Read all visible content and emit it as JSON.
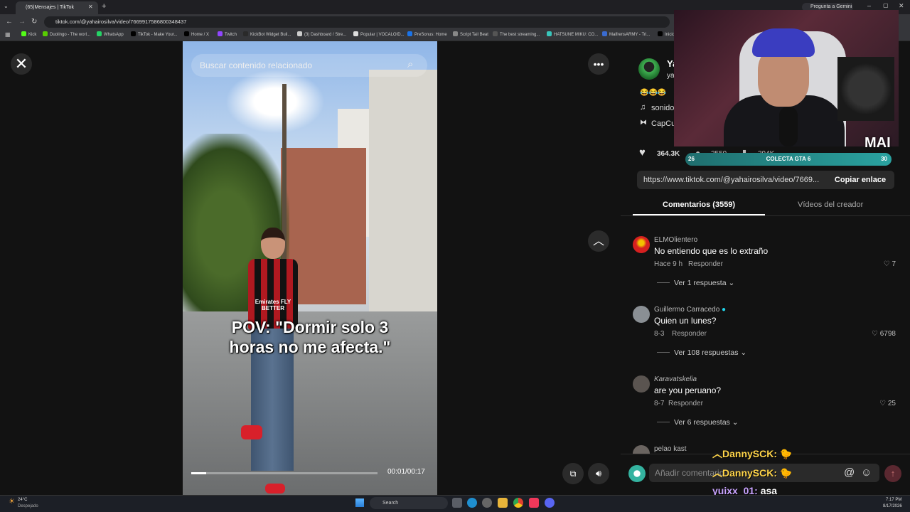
{
  "browser": {
    "tab_title": "(65)Mensajes | TikTok",
    "new_tab": "+",
    "address": "tiktok.com/@yahairosilva/video/7669917586800348437",
    "gemini": "Pregunta a Gemini",
    "bookmarks": [
      "Kick",
      "Duolingo - The worl...",
      "WhatsApp",
      "TikTok - Make Your...",
      "Home / X",
      "Twitch",
      "KickBot Widget Buil...",
      "(3) Dashboard / Stre...",
      "Popular | VOCALOID...",
      "PreSonus: Home",
      "Script Tail Beat",
      "The best streaming...",
      "HATSUNE MIKU: CO...",
      "MaifrensARMY - Tri...",
      "Inicio"
    ]
  },
  "video": {
    "search_placeholder": "Buscar contenido relacionado",
    "caption_line1": "POV: \"Dormir solo 3",
    "caption_line2": "horas no me afecta.\"",
    "time": "00:01/00:17",
    "jersey_text": "Emirates FLY BETTER",
    "progress": 0.08
  },
  "author": {
    "name_partial": "Ya",
    "handle_partial": "ya",
    "emojis": "😂😂😂",
    "sound_partial": "sonido",
    "capcut_partial": "CapCu"
  },
  "stats": {
    "likes": "364.3K",
    "comments_partial": "3559",
    "saves_partial": "394K"
  },
  "overlay": {
    "gta_label": "COLECTA GTA 6",
    "gta_left": "26",
    "gta_right": "30",
    "brand": "MAI"
  },
  "link": {
    "url": "https://www.tiktok.com/@yahairosilva/video/7669...",
    "copy_label": "Copiar enlace"
  },
  "tabs": {
    "comments": "Comentarios (3559)",
    "creator_videos": "Vídeos del creador"
  },
  "comments": [
    {
      "user": "ELMOlientero",
      "text": "No entiendo que es lo extraño",
      "date": "Hace 9 h",
      "reply": "Responder",
      "likes": "7",
      "more": "Ver 1 respuesta"
    },
    {
      "user": "Guillermo Carracedo",
      "text": "Quien un lunes?",
      "date": "8-3",
      "reply": "Responder",
      "likes": "6798",
      "more": "Ver 108 respuestas"
    },
    {
      "user": "Karavatskelia",
      "text": "are you peruano?",
      "date": "8-7",
      "reply": "Responder",
      "likes": "25",
      "more": "Ver 6 respuestas"
    },
    {
      "user": "pelao kast"
    }
  ],
  "comment_input": {
    "placeholder": "Añadir comentario..."
  },
  "chat": [
    {
      "user": "DannySCK:",
      "text": ""
    },
    {
      "user": "DannySCK:",
      "text": ""
    },
    {
      "user": "yuixx_01:",
      "text": "asa"
    }
  ],
  "taskbar": {
    "temp": "24°C",
    "weather": "Despejado",
    "search": "Search",
    "time": "7:17 PM",
    "date": "8/17/2026"
  }
}
